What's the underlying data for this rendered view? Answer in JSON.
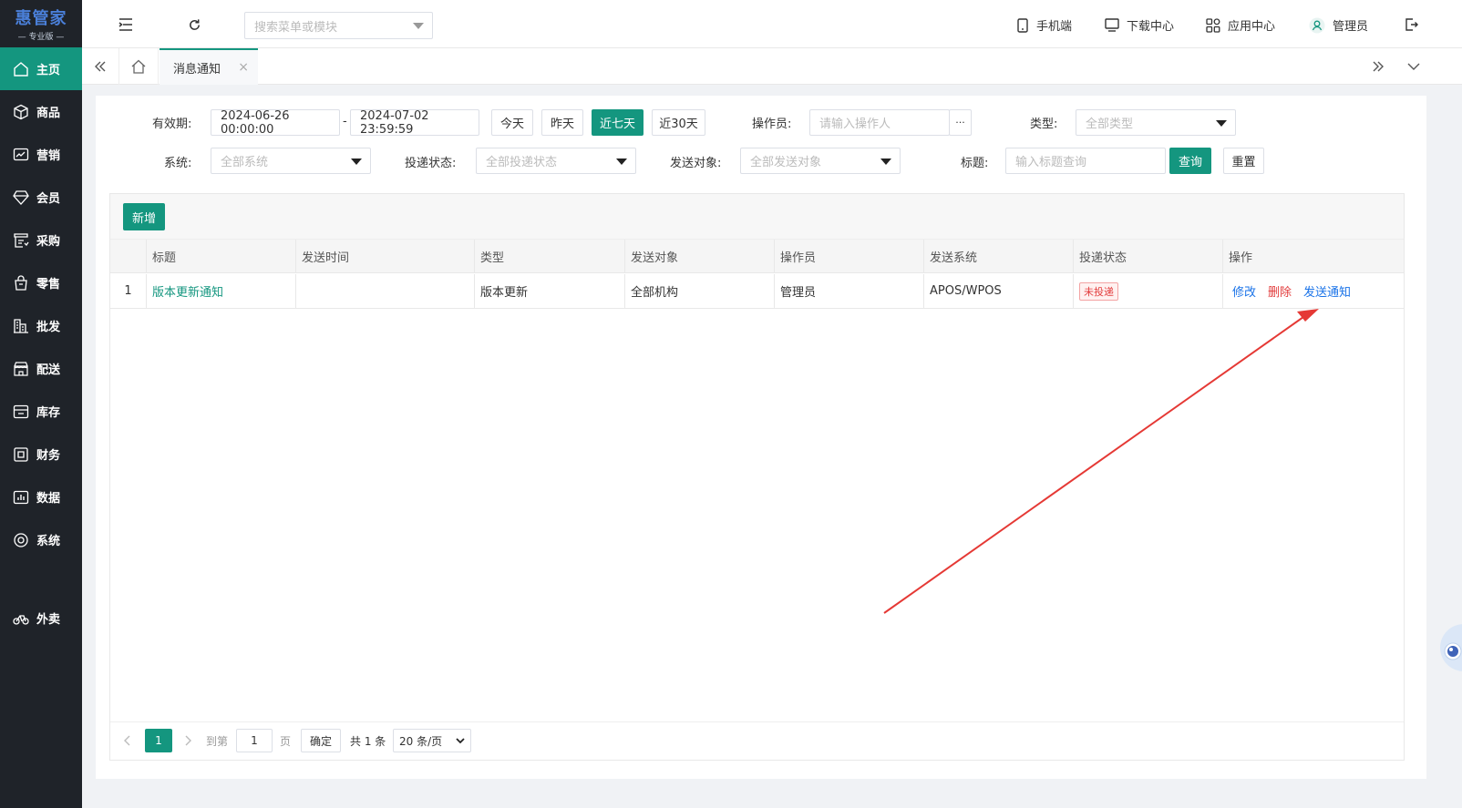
{
  "app": {
    "logo_main": "惠管家",
    "logo_sub": "专业版"
  },
  "sidebar": {
    "items": [
      {
        "label": "主页",
        "icon": "home-icon",
        "active": true
      },
      {
        "label": "商品",
        "icon": "box-icon"
      },
      {
        "label": "营销",
        "icon": "chart-card-icon"
      },
      {
        "label": "会员",
        "icon": "diamond-icon"
      },
      {
        "label": "采购",
        "icon": "clipboard-icon"
      },
      {
        "label": "零售",
        "icon": "bag-icon"
      },
      {
        "label": "批发",
        "icon": "building-icon"
      },
      {
        "label": "配送",
        "icon": "store-icon"
      },
      {
        "label": "库存",
        "icon": "drawer-icon"
      },
      {
        "label": "财务",
        "icon": "ledger-icon"
      },
      {
        "label": "数据",
        "icon": "bar-chart-icon"
      },
      {
        "label": "系统",
        "icon": "settings-icon"
      },
      {
        "label": "外卖",
        "icon": "bike-icon"
      }
    ]
  },
  "topbar": {
    "search_placeholder": "搜索菜单或模块",
    "mobile": "手机端",
    "download": "下载中心",
    "apps": "应用中心",
    "user": "管理员"
  },
  "tabs": {
    "active_label": "消息通知",
    "close": "×"
  },
  "filters": {
    "validity_label": "有效期:",
    "date_start": "2024-06-26 00:00:00",
    "date_sep": "-",
    "date_end": "2024-07-02 23:59:59",
    "btn_today": "今天",
    "btn_yesterday": "昨天",
    "btn_7days": "近七天",
    "btn_30days": "近30天",
    "operator_label": "操作员:",
    "operator_placeholder": "请输入操作人",
    "operator_more": "···",
    "type_label": "类型:",
    "type_value": "全部类型",
    "system_label": "系统:",
    "system_value": "全部系统",
    "delivery_label": "投递状态:",
    "delivery_value": "全部投递状态",
    "target_label": "发送对象:",
    "target_value": "全部发送对象",
    "title_label": "标题:",
    "title_placeholder": "输入标题查询",
    "btn_query": "查询",
    "btn_reset": "重置"
  },
  "table": {
    "btn_add": "新增",
    "headers": [
      "标题",
      "发送时间",
      "类型",
      "发送对象",
      "操作员",
      "发送系统",
      "投递状态",
      "操作"
    ],
    "rows": [
      {
        "index": "1",
        "title": "版本更新通知",
        "send_time": "",
        "type": "版本更新",
        "target": "全部机构",
        "operator": "管理员",
        "system": "APOS/WPOS",
        "status": "未投递",
        "op_edit": "修改",
        "op_delete": "删除",
        "op_send": "发送通知"
      }
    ]
  },
  "pagination": {
    "current": "1",
    "goto_label": "到第",
    "goto_value": "1",
    "page_unit": "页",
    "confirm": "确定",
    "total": "共 1 条",
    "page_size": "20 条/页"
  },
  "colors": {
    "brand": "#14967f",
    "sidebar_bg": "#1f2329",
    "link_blue": "#1a73e8",
    "danger": "#e23c3c",
    "annotation_arrow": "#e53935"
  }
}
